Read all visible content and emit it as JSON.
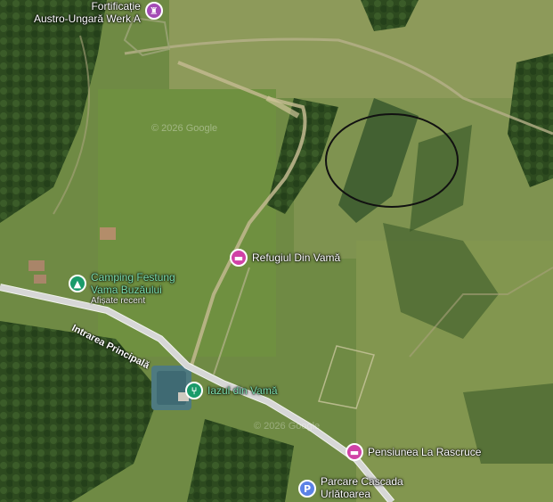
{
  "map": {
    "type": "satellite",
    "watermark": "© 2026 Google",
    "colors": {
      "lodging_pin": "#d042a6",
      "campground_pin": "#1a9b6a",
      "food_pin": "#1a9b6a",
      "parking_pin": "#5b82e6",
      "marker_pin": "#a44bb5",
      "annotation_ellipse": "#111111"
    }
  },
  "road": {
    "name": "Intrarea Principală"
  },
  "places": [
    {
      "id": "fortificatie",
      "line1": "Fortificație",
      "line2": "Austro-Ungară Werk A",
      "icon": "castle-icon"
    },
    {
      "id": "camping",
      "line1": "Camping Festung",
      "line2": "Vama Buzăului",
      "note": "Afișate recent",
      "icon": "campground-icon"
    },
    {
      "id": "refugiul",
      "line1": "Refugiul Din Vamă",
      "icon": "bed-icon"
    },
    {
      "id": "iazul",
      "line1": "Iazul din Vamă",
      "icon": "restaurant-icon"
    },
    {
      "id": "pensiunea",
      "line1": "Pensiunea La Rascruce",
      "icon": "bed-icon"
    },
    {
      "id": "parcare",
      "line1": "Parcare Cascada",
      "line2": "Urlătoarea",
      "icon": "parking-icon"
    }
  ]
}
